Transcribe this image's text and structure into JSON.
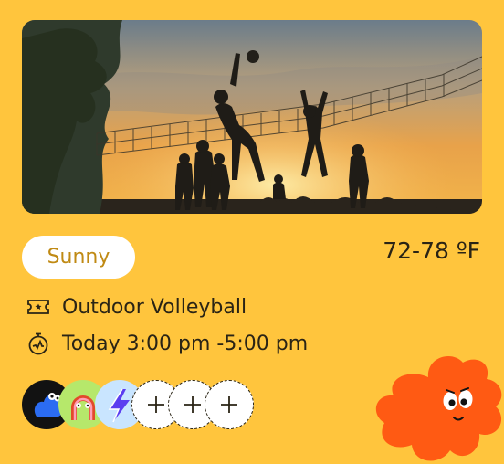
{
  "event": {
    "weather_label": "Sunny",
    "temperature": "72-78 ºF",
    "title": "Outdoor Volleyball",
    "time": "Today 3:00 pm -5:00 pm"
  },
  "participants": {
    "avatars": [
      {
        "name": "avatar-1",
        "color": "#121212"
      },
      {
        "name": "avatar-2",
        "color": "#b6e86b"
      },
      {
        "name": "avatar-3",
        "color": "#c9e5ff"
      }
    ],
    "add_slots": 3
  },
  "icons": {
    "ticket": "ticket-icon",
    "time": "stopwatch-icon",
    "add": "plus-icon",
    "mascot": "orange-blob-mascot-icon"
  },
  "colors": {
    "card_bg": "#ffc53d",
    "badge_text": "#c08a14",
    "text": "#2a2415",
    "blob": "#ff5a13"
  }
}
